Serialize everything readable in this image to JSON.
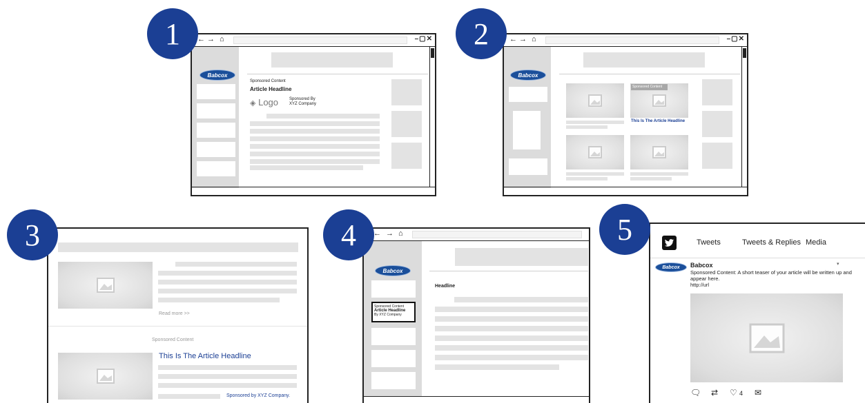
{
  "badges": [
    "1",
    "2",
    "3",
    "4",
    "5"
  ],
  "brand": "Babcox",
  "nav": {
    "back": "←",
    "forward": "→",
    "home": "⌂",
    "controls": "–▢✕"
  },
  "m1": {
    "label": "Sponsored Content",
    "headline": "Article Headline",
    "logo_text": "Logo",
    "sponsored_by": "Sponsored By",
    "company": "XYZ Company"
  },
  "m2": {
    "label": "Sponsored Content",
    "headline": "This Is The Article Headline"
  },
  "m3": {
    "read_more": "Read more >>",
    "label": "Sponsored Content",
    "headline": "This Is The Article Headline",
    "sponsored_by": "Sponsored by XYZ Company."
  },
  "m4": {
    "label": "Sponsored Content",
    "article": "Article Headline",
    "by": "By XYZ Company",
    "headline": "Headline"
  },
  "m5": {
    "tabs": [
      "Tweets",
      "Tweets & Replies",
      "Media"
    ],
    "author": "Babcox",
    "text": "Sponsored Content: A short teaser of your article will be written up and appear here.",
    "url": "http://url",
    "likes": "4"
  }
}
